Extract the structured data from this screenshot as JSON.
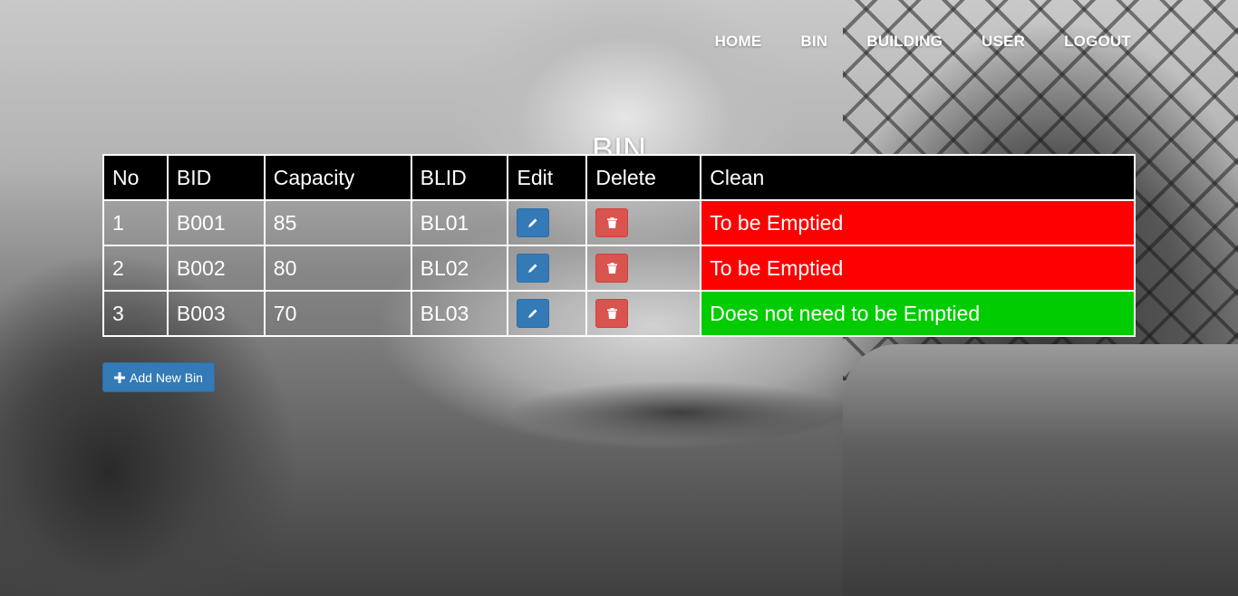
{
  "nav": {
    "items": [
      "HOME",
      "BIN",
      "BUILDING",
      "USER",
      "LOGOUT"
    ]
  },
  "page": {
    "title": "BIN"
  },
  "table": {
    "headers": [
      "No",
      "BID",
      "Capacity",
      "BLID",
      "Edit",
      "Delete",
      "Clean"
    ],
    "rows": [
      {
        "no": "1",
        "bid": "B001",
        "capacity": "85",
        "blid": "BL01",
        "clean": "To be Emptied",
        "status": "red"
      },
      {
        "no": "2",
        "bid": "B002",
        "capacity": "80",
        "blid": "BL02",
        "clean": "To be Emptied",
        "status": "red"
      },
      {
        "no": "3",
        "bid": "B003",
        "capacity": "70",
        "blid": "BL03",
        "clean": "Does not need to be Emptied",
        "status": "green"
      }
    ]
  },
  "actions": {
    "add_label": "Add New Bin"
  },
  "colors": {
    "to_be_emptied": "#ff0000",
    "not_needed": "#00cc00",
    "edit_button": "#337ab7",
    "delete_button": "#d9534f",
    "header_bg": "#000000"
  },
  "icons": {
    "edit": "pencil-icon",
    "delete": "trash-icon",
    "add": "plus-icon"
  }
}
